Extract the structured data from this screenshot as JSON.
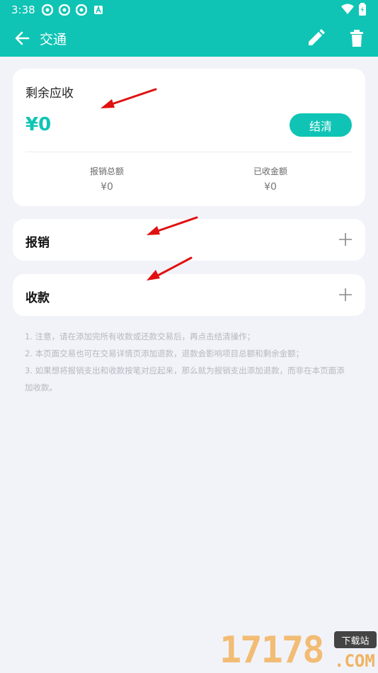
{
  "status": {
    "time": "3:38"
  },
  "appbar": {
    "title": "交通"
  },
  "summary": {
    "title": "剩余应收",
    "amount": "¥0",
    "settle_label": "结清",
    "reimburse_total_label": "报销总额",
    "reimburse_total_value": "¥0",
    "received_total_label": "已收金额",
    "received_total_value": "¥0"
  },
  "sections": {
    "reimburse_label": "报销",
    "receive_label": "收款"
  },
  "notes": [
    "1. 注意，请在添加完所有收款或还款交易后，再点击结清操作；",
    "2. 本页面交易也可在交易详情页添加退款，退款会影响项目总额和剩余金额；",
    "3. 如果想将报销支出和收款按笔对应起来，那么就为报销支出添加退款，而非在本页面添加收款。"
  ],
  "watermark": {
    "number": "17178",
    "badge": "下载站",
    "domain": ".COM"
  },
  "colors": {
    "accent": "#0fc4b5",
    "arrow": "#e01010"
  }
}
